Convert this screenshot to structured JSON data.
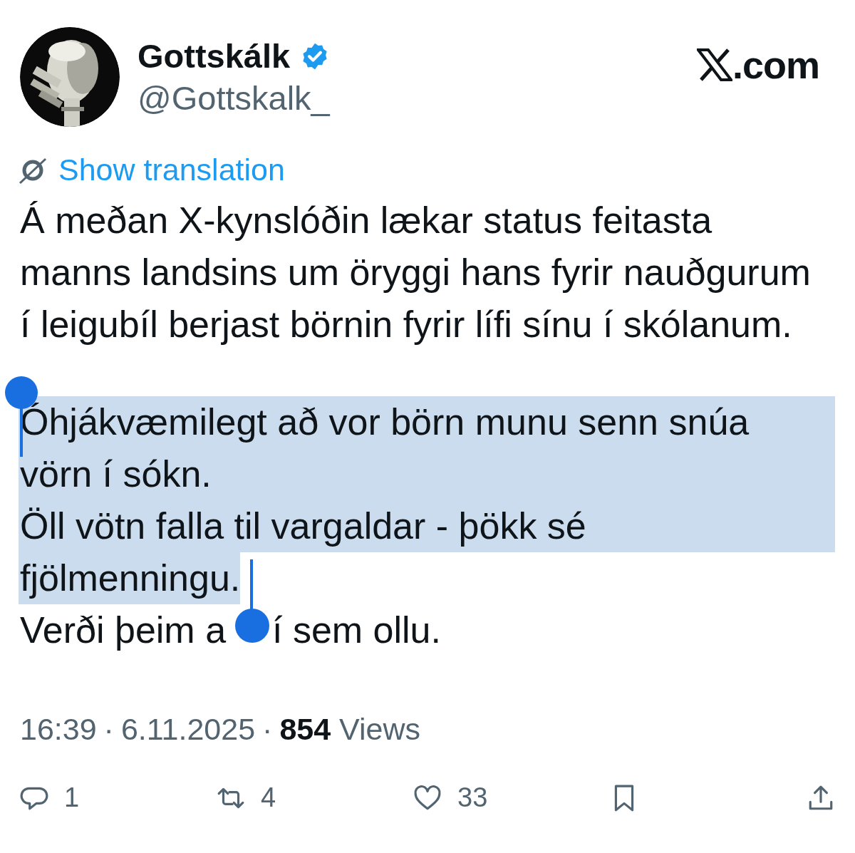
{
  "author": {
    "name": "Gottskálk",
    "verified": true,
    "handle": "@Gottskalk_"
  },
  "site": {
    "label": ".com"
  },
  "translate_link": "Show translation",
  "body": [
    {
      "lines": [
        {
          "text": "Á meðan X-kynslóðin lækar status feitasta",
          "selected": false
        },
        {
          "text": "manns landsins um öryggi hans fyrir nauðgurum",
          "selected": false
        },
        {
          "text": "í leigubíl berjast börnin fyrir lífi sínu í skólanum.",
          "selected": false
        }
      ]
    },
    {
      "lines": [
        {
          "text": "Óhjákvæmilegt að vor börn munu senn snúa",
          "selected": true
        },
        {
          "text": "vörn í sókn.",
          "selected": true
        },
        {
          "text": "Öll vötn falla til vargaldar - þökk sé",
          "selected": true
        },
        {
          "text": "fjölmenningu.",
          "selected": true
        },
        {
          "text": "Verði þeim a",
          "text_after_handle": "í sem ollu.",
          "selected": false
        }
      ]
    }
  ],
  "meta": {
    "time": "16:39",
    "separator": "·",
    "date": "6.11.2025",
    "separator_2": "·",
    "views_count": "854",
    "views_label": "Views"
  },
  "actions": [
    {
      "kind": "reply",
      "count": "1"
    },
    {
      "kind": "repost",
      "count": "4"
    },
    {
      "kind": "like",
      "count": "33"
    },
    {
      "kind": "bookmark"
    },
    {
      "kind": "share"
    }
  ]
}
